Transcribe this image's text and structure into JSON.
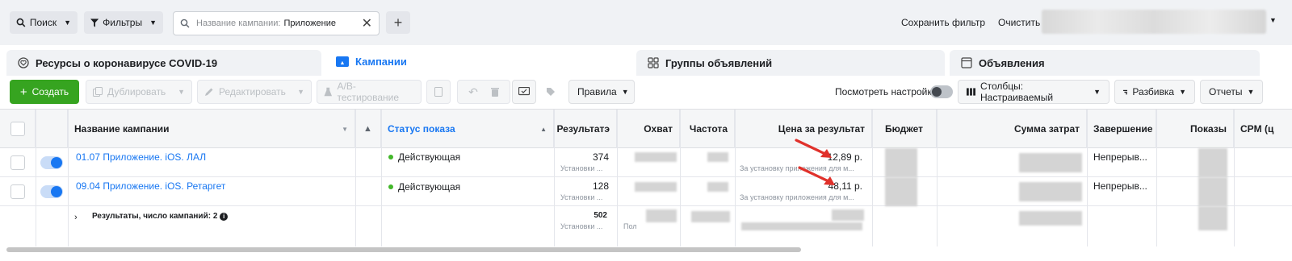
{
  "topbar": {
    "search_label": "Поиск",
    "filters_label": "Фильтры",
    "search_placeholder": "Название кампании:",
    "search_value": "Приложение",
    "add_label": "+",
    "save_filter": "Сохранить фильтр",
    "clear": "Очистить"
  },
  "tabs": [
    {
      "label": "Ресурсы о коронавирусе COVID-19"
    },
    {
      "label": "Кампании"
    },
    {
      "label": "Группы объявлений"
    },
    {
      "label": "Объявления"
    }
  ],
  "toolbar": {
    "create": "Создать",
    "duplicate": "Дублировать",
    "edit": "Редактировать",
    "ab_test": "A/B-тестирование",
    "rules": "Правила",
    "view_settings": "Посмотреть настройки",
    "columns": "Столбцы: Настраиваемый",
    "breakdown": "Разбивка",
    "reports": "Отчеты"
  },
  "table": {
    "headers": {
      "name": "Название кампании",
      "status": "Статус показа",
      "results": "Результатэ",
      "reach": "Охват",
      "frequency": "Частота",
      "cost_per_result": "Цена за результат",
      "budget": "Бюджет",
      "amount_spent": "Сумма затрат",
      "ends": "Завершение",
      "impressions": "Показы",
      "cpm": "CPM (ц"
    },
    "rows": [
      {
        "name": "01.07 Приложение. iOS. ЛАЛ",
        "status": "Действующая",
        "results": "374",
        "results_sub": "Установки ...",
        "cost": "12,89 р.",
        "cost_sub": "За установку приложения для м...",
        "ends": "Непрерыв..."
      },
      {
        "name": "09.04 Приложение. iOS. Ретаргет",
        "status": "Действующая",
        "results": "128",
        "results_sub": "Установки ...",
        "cost": "48,11 р.",
        "cost_sub": "За установку приложения для м...",
        "ends": "Непрерыв..."
      }
    ],
    "summary": {
      "label": "Результаты, число кампаний: 2",
      "results": "502",
      "results_sub": "Установки ...",
      "reach_sub": "Пол"
    }
  },
  "colors": {
    "accent": "#1877f2",
    "create_green": "#36a420",
    "status_green": "#42b72a",
    "arrow_red": "#e0312b"
  }
}
